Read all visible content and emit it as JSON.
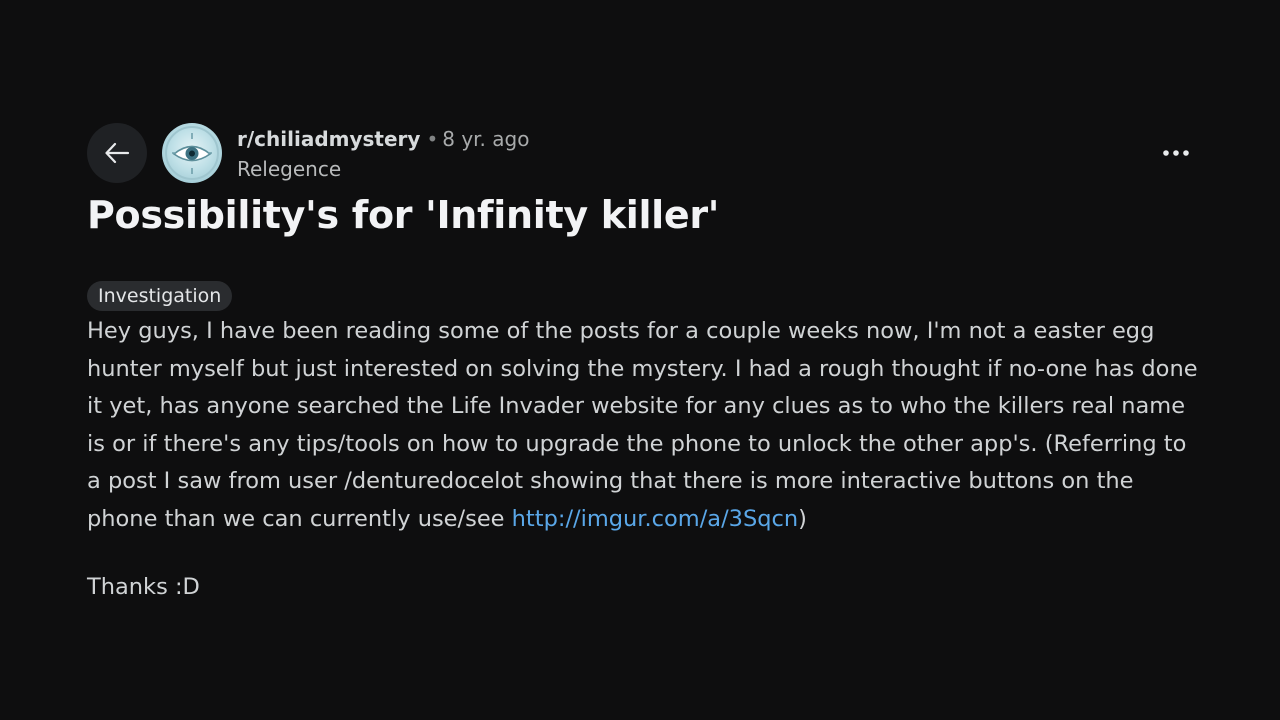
{
  "post": {
    "subreddit": "r/chiliadmystery",
    "separator": "•",
    "time_ago": "8 yr. ago",
    "author": "Relegence",
    "title": "Possibility's for 'Infinity killer'",
    "flair": "Investigation",
    "body_text": "Hey guys, I have been reading some of the posts for a couple weeks now, I'm not a easter egg hunter myself but just interested on solving the mystery. I had a rough thought if no-one has done it yet, has anyone searched the Life Invader website for any clues as to who the killers real name is or if there's any tips/tools on how to upgrade the phone to unlock the other app's. (Referring to a post I saw from user /denturedocelot showing that there is more interactive buttons on the phone than we can currently use/see ",
    "link_text": "http://imgur.com/a/3Sqcn",
    "link_suffix": ")",
    "closing": "Thanks :D"
  },
  "icons": {
    "back": "arrow-left-icon",
    "more": "more-horizontal-icon",
    "avatar": "subreddit-avatar-eye-icon"
  },
  "colors": {
    "background": "#0e0e0f",
    "link": "#5aa7e8",
    "flair_bg": "#2a2c2f",
    "back_button_bg": "#1f2124"
  }
}
